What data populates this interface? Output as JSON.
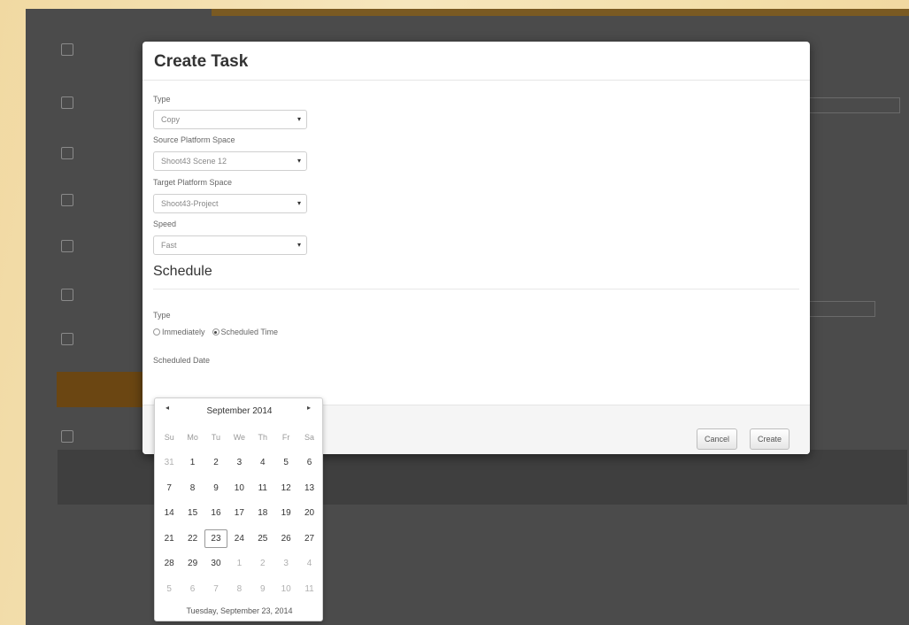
{
  "modal": {
    "title": "Create Task",
    "type_label": "Type",
    "type_value": "Copy",
    "source_label": "Source Platform Space",
    "source_value": "Shoot43 Scene 12",
    "target_label": "Target Platform Space",
    "target_value": "Shoot43-Project",
    "speed_label": "Speed",
    "speed_value": "Fast",
    "schedule_title": "Schedule",
    "schedule_type_label": "Type",
    "radio_immediately": "Immediately",
    "radio_scheduled": "Scheduled Time",
    "scheduled_date_label": "Scheduled Date",
    "cancel_label": "Cancel",
    "create_label": "Create"
  },
  "datepicker": {
    "month_label": "September 2014",
    "prev_icon": "◂",
    "next_icon": "▸",
    "weekdays": [
      "Su",
      "Mo",
      "Tu",
      "We",
      "Th",
      "Fr",
      "Sa"
    ],
    "weeks": [
      [
        "31",
        "1",
        "2",
        "3",
        "4",
        "5",
        "6"
      ],
      [
        "7",
        "8",
        "9",
        "10",
        "11",
        "12",
        "13"
      ],
      [
        "14",
        "15",
        "16",
        "17",
        "18",
        "19",
        "20"
      ],
      [
        "21",
        "22",
        "23",
        "24",
        "25",
        "26",
        "27"
      ],
      [
        "28",
        "29",
        "30",
        "1",
        "2",
        "3",
        "4"
      ],
      [
        "5",
        "6",
        "7",
        "8",
        "9",
        "10",
        "11"
      ]
    ],
    "selected_day": "23",
    "footer": "Tuesday, September 23, 2014"
  },
  "icons": {
    "calendar": "calendar-icon",
    "clock": "clock-icon",
    "cursor": "hand-cursor-icon"
  }
}
